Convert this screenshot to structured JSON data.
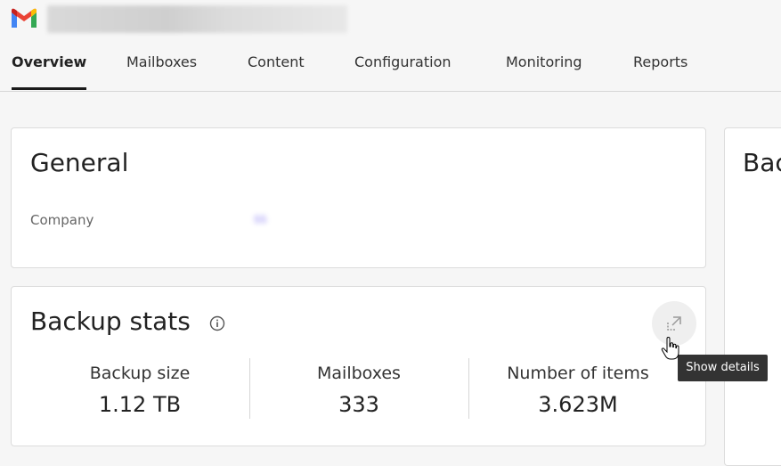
{
  "app": {
    "logo_icon": "gmail-logo-icon"
  },
  "tabs": [
    {
      "label": "Overview",
      "active": true
    },
    {
      "label": "Mailboxes"
    },
    {
      "label": "Content"
    },
    {
      "label": "Configuration"
    },
    {
      "label": "Monitoring"
    },
    {
      "label": "Reports"
    }
  ],
  "general": {
    "title": "General",
    "company_label": "Company",
    "company_value": "ss"
  },
  "backup_stats": {
    "title": "Backup stats",
    "stats": [
      {
        "label": "Backup size",
        "value": "1.12 TB"
      },
      {
        "label": "Mailboxes",
        "value": "333"
      },
      {
        "label": "Number of items",
        "value": "3.623M"
      }
    ],
    "tooltip": "Show details"
  },
  "right_card": {
    "title": "Bac"
  },
  "colors": {
    "accent_link": "#6b5cf0",
    "tooltip_bg": "#333333",
    "tab_underline": "#1a1a1a"
  }
}
